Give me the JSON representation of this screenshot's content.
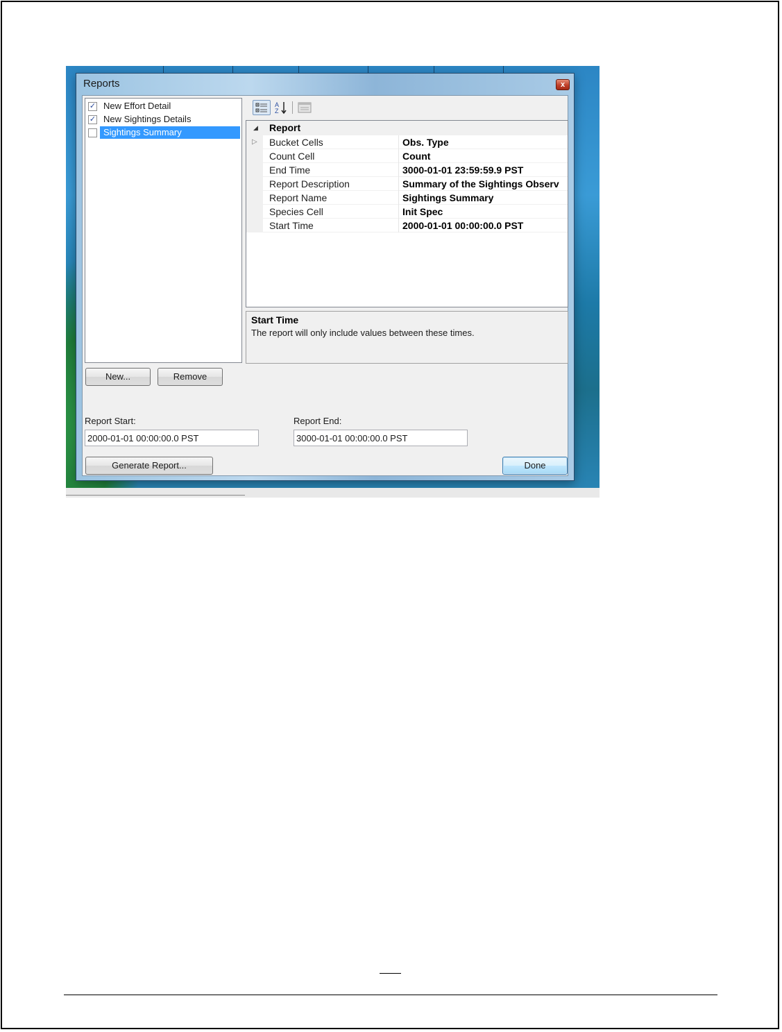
{
  "window": {
    "title": "Reports",
    "close_glyph": "x"
  },
  "report_list": {
    "items": [
      {
        "label": "New Effort Detail",
        "checked": true,
        "selected": false
      },
      {
        "label": "New Sightings Details",
        "checked": true,
        "selected": false
      },
      {
        "label": "Sightings Summary",
        "checked": false,
        "selected": true
      }
    ]
  },
  "toolbar": {
    "buttons": [
      {
        "icon": "categorized-icon",
        "active": true
      },
      {
        "icon": "sort-alphabetical-icon",
        "active": false
      },
      {
        "icon": "property-pages-icon",
        "active": false
      }
    ]
  },
  "property_grid": {
    "category": "Report",
    "rows": [
      {
        "name": "Bucket Cells",
        "value": "Obs. Type",
        "expandable": true
      },
      {
        "name": "Count Cell",
        "value": "Count",
        "expandable": false
      },
      {
        "name": "End Time",
        "value": "3000-01-01 23:59:59.9 PST",
        "expandable": false
      },
      {
        "name": "Report Description",
        "value": "Summary of the Sightings Observ",
        "expandable": false
      },
      {
        "name": "Report Name",
        "value": "Sightings Summary",
        "expandable": false
      },
      {
        "name": "Species Cell",
        "value": "Init Spec",
        "expandable": false
      },
      {
        "name": "Start Time",
        "value": "2000-01-01 00:00:00.0 PST",
        "expandable": false
      }
    ]
  },
  "help": {
    "title": "Start Time",
    "description": "The report will only include values between these times."
  },
  "buttons": {
    "new": "New...",
    "remove": "Remove",
    "generate": "Generate Report...",
    "done": "Done"
  },
  "report_start": {
    "label": "Report Start:",
    "value": "2000-01-01 00:00:00.0 PST"
  },
  "report_end": {
    "label": "Report End:",
    "value": "3000-01-01 00:00:00.0 PST"
  }
}
